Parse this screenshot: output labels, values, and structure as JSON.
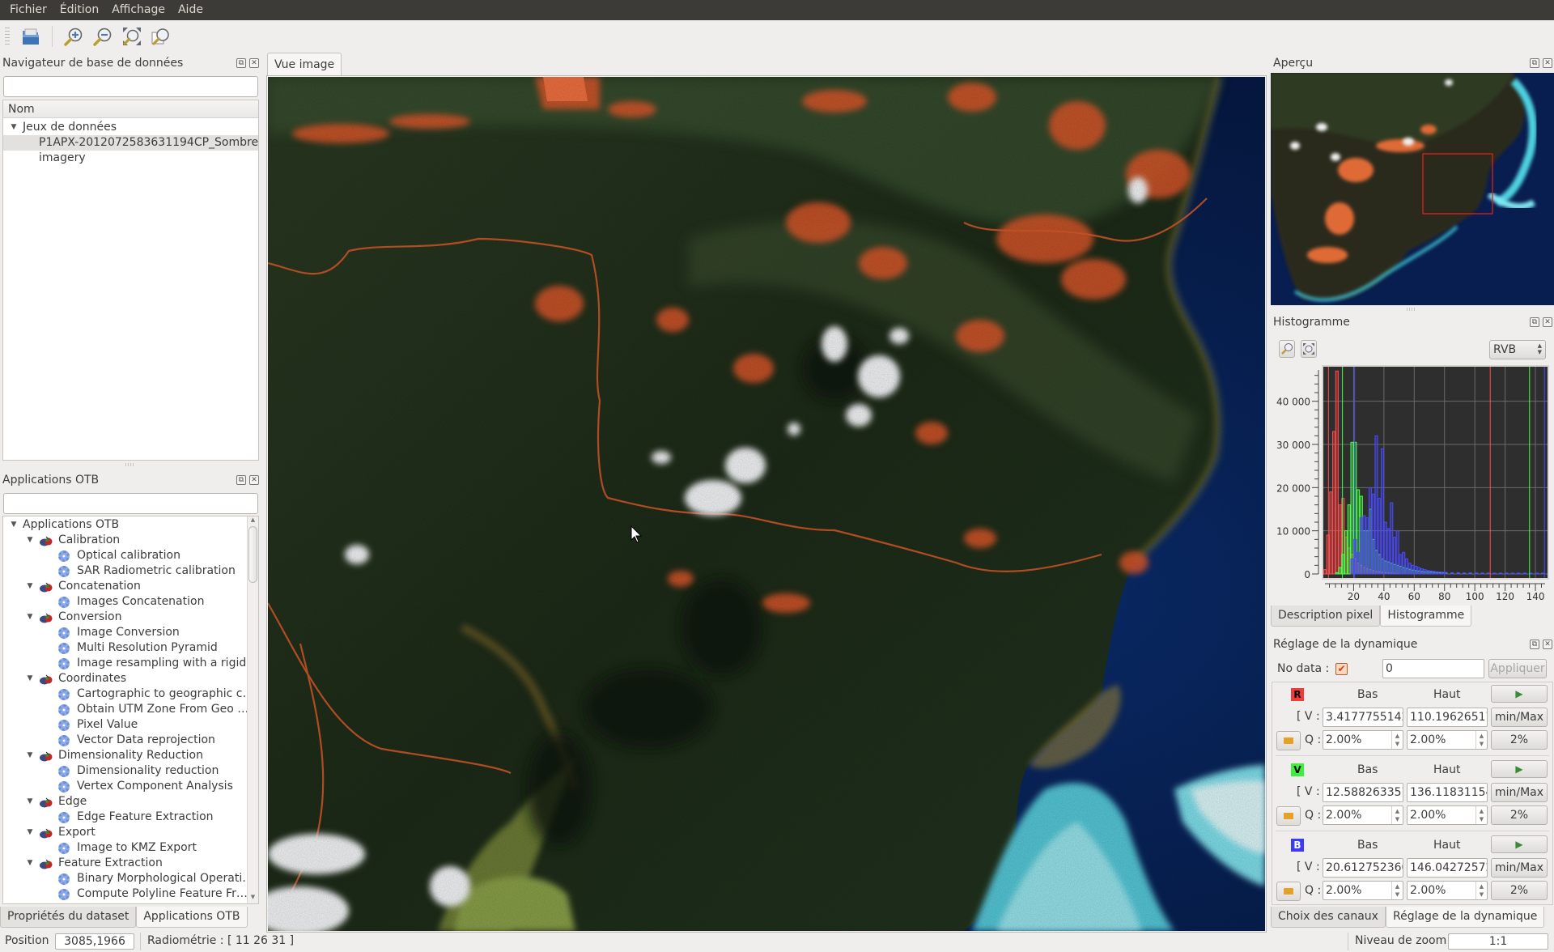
{
  "menu": [
    "Fichier",
    "Édition",
    "Affichage",
    "Aide"
  ],
  "toolbar": {
    "icons": [
      "open-folder-icon",
      "zoom-in-icon",
      "zoom-out-icon",
      "zoom-extent-icon",
      "zoom-full-resolution-icon"
    ]
  },
  "db_navigator": {
    "title": "Navigateur de base de données",
    "search_value": "",
    "column": "Nom",
    "root": "Jeux de données",
    "items": [
      "P1APX-2012072583631194CP_Sombre",
      "imagery"
    ]
  },
  "otb_apps": {
    "title": "Applications OTB",
    "search_value": "",
    "root": "Applications OTB",
    "categories": [
      {
        "name": "Calibration",
        "apps": [
          "Optical calibration",
          "SAR Radiometric calibration"
        ]
      },
      {
        "name": "Concatenation",
        "apps": [
          "Images Concatenation"
        ]
      },
      {
        "name": "Conversion",
        "apps": [
          "Image Conversion",
          "Multi Resolution Pyramid",
          "Image resampling with a rigid…"
        ]
      },
      {
        "name": "Coordinates",
        "apps": [
          "Cartographic to geographic c…",
          "Obtain UTM Zone From Geo …",
          "Pixel Value",
          "Vector Data reprojection"
        ]
      },
      {
        "name": "Dimensionality Reduction",
        "apps": [
          "Dimensionality reduction",
          "Vertex Component Analysis"
        ]
      },
      {
        "name": "Edge",
        "apps": [
          "Edge Feature Extraction"
        ]
      },
      {
        "name": "Export",
        "apps": [
          "Image to KMZ Export"
        ]
      },
      {
        "name": "Feature Extraction",
        "apps": [
          "Binary Morphological Operati…",
          "Compute Polyline Feature Fr…"
        ]
      }
    ]
  },
  "left_tabs": [
    "Propriétés du dataset",
    "Applications OTB"
  ],
  "left_active_tab": "Applications OTB",
  "center_tab": "Vue image",
  "overview": {
    "title": "Aperçu"
  },
  "histogram": {
    "title": "Histogramme",
    "mode": "RVB",
    "tabs": [
      "Description pixel",
      "Histogramme"
    ],
    "active_tab": "Histogramme"
  },
  "dynamics": {
    "title": "Réglage de la dynamique",
    "nodata_label": "No data :",
    "nodata_checked": true,
    "nodata_value": "0",
    "apply_label": "Appliquer",
    "col_low": "Bas",
    "col_high": "Haut",
    "v_label": "[ V :",
    "q_label": "Q :",
    "minmax_label": "min/Max",
    "pct_label": "2%",
    "channels": [
      {
        "letter": "R",
        "color": "#f03c3c",
        "text_color": "#000000",
        "low_v": "3.4177755142",
        "high_v": "110.19626517",
        "low_q": "2.00%",
        "high_q": "2.00%"
      },
      {
        "letter": "V",
        "color": "#3cf03c",
        "text_color": "#000000",
        "low_v": "12.588263357",
        "high_v": "136.11831154",
        "low_q": "2.00%",
        "high_q": "2.00%"
      },
      {
        "letter": "B",
        "color": "#3c3cf0",
        "text_color": "#ffffff",
        "low_v": "20.612752360",
        "high_v": "146.04272572",
        "low_q": "2.00%",
        "high_q": "2.00%"
      }
    ],
    "tabs": [
      "Choix des canaux",
      "Réglage de la dynamique"
    ],
    "active_tab": "Réglage de la dynamique"
  },
  "status": {
    "position_label": "Position",
    "position_value": "3085,1966",
    "radiometry": "Radiométrie : [ 11 26 31 ]",
    "zoom_label": "Niveau de zoom",
    "zoom_value": "1:1"
  },
  "chart_data": {
    "type": "bar",
    "title": "Histogramme",
    "xlabel": "",
    "ylabel": "",
    "xlim": [
      0,
      148
    ],
    "ylim": [
      0,
      48000
    ],
    "xticks": [
      20,
      40,
      60,
      80,
      100,
      120,
      140
    ],
    "yticks": [
      0,
      10000,
      20000,
      30000,
      40000
    ],
    "ytick_labels": [
      "0",
      "10 000",
      "20 000",
      "30 000",
      "40 000"
    ],
    "grid": true,
    "bin_width": 2,
    "series": [
      {
        "name": "R",
        "color": "#ff4a4a",
        "x": [
          1,
          3,
          5,
          7,
          9,
          11,
          13,
          15,
          17,
          19,
          21,
          23,
          25,
          27,
          29,
          31,
          33,
          35,
          37,
          39,
          41,
          43,
          45,
          47,
          49
        ],
        "values": [
          1000,
          9000,
          19000,
          33000,
          47000,
          16000,
          17500,
          8500,
          6000,
          4500,
          3500,
          2500,
          2000,
          1500,
          1200,
          1000,
          800,
          600,
          500,
          400,
          300,
          250,
          200,
          150,
          100
        ],
        "low_marker": 3.42,
        "high_marker": 110.2
      },
      {
        "name": "V",
        "color": "#4aff4a",
        "x": [
          9,
          11,
          13,
          15,
          17,
          19,
          21,
          23,
          25,
          27,
          29,
          31,
          33,
          35,
          37,
          39,
          41,
          43,
          45,
          47,
          49,
          51,
          53,
          55,
          57,
          59,
          61,
          63,
          65,
          67,
          69,
          71,
          73,
          75,
          77,
          79,
          81,
          85,
          89,
          93,
          97,
          101,
          105,
          109,
          113,
          117,
          121,
          125,
          129,
          133,
          137,
          141,
          145
        ],
        "values": [
          300,
          1500,
          4500,
          10000,
          16000,
          30500,
          30500,
          19500,
          18000,
          10000,
          10000,
          15000,
          8000,
          5500,
          4500,
          3500,
          3000,
          2800,
          2500,
          2200,
          2000,
          1800,
          1500,
          1300,
          1100,
          900,
          800,
          700,
          600,
          500,
          500,
          450,
          400,
          350,
          300,
          300,
          250,
          250,
          250,
          200,
          200,
          200,
          200,
          200,
          150,
          150,
          150,
          150,
          150,
          150,
          150,
          150,
          150
        ],
        "low_marker": 12.59,
        "high_marker": 136.1
      },
      {
        "name": "B",
        "color": "#4a4aff",
        "x": [
          19,
          21,
          23,
          25,
          27,
          29,
          31,
          33,
          35,
          37,
          39,
          41,
          43,
          45,
          47,
          49,
          51,
          53,
          55,
          57,
          59,
          61,
          63,
          65,
          67,
          69,
          71,
          73,
          75,
          77,
          79,
          81,
          85,
          89,
          93,
          97,
          101,
          105,
          109,
          113,
          117,
          121,
          125,
          129,
          133,
          137,
          141,
          145
        ],
        "values": [
          3500,
          8000,
          5000,
          13000,
          13500,
          13000,
          20000,
          18500,
          32000,
          17500,
          29000,
          12000,
          10500,
          16500,
          8500,
          10000,
          4500,
          5000,
          3500,
          2500,
          2000,
          1800,
          1500,
          1200,
          1000,
          800,
          700,
          600,
          500,
          450,
          400,
          350,
          300,
          300,
          250,
          250,
          200,
          200,
          200,
          200,
          200,
          200,
          200,
          200,
          200,
          200,
          200,
          200
        ],
        "low_marker": 20.61,
        "high_marker": 146.0
      }
    ]
  }
}
